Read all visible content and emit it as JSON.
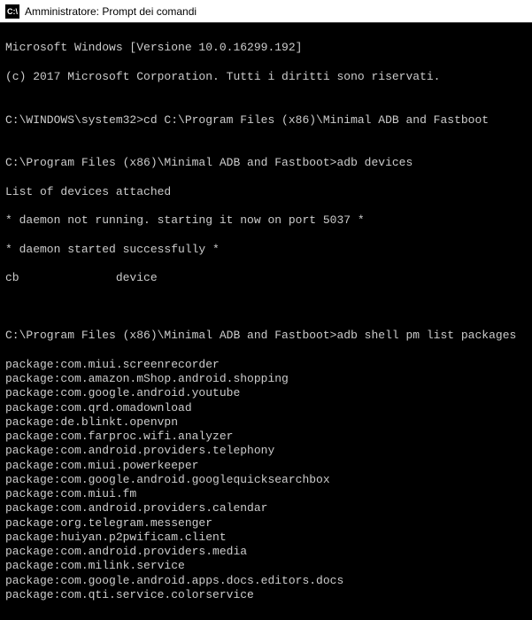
{
  "titlebar": {
    "icon_text": "C:\\",
    "title": "Amministratore: Prompt dei comandi"
  },
  "terminal": {
    "header1": "Microsoft Windows [Versione 10.0.16299.192]",
    "header2": "(c) 2017 Microsoft Corporation. Tutti i diritti sono riservati.",
    "blank": "",
    "prompt1": "C:\\WINDOWS\\system32>cd C:\\Program Files (x86)\\Minimal ADB and Fastboot",
    "prompt2": "C:\\Program Files (x86)\\Minimal ADB and Fastboot>adb devices",
    "dev_list_header": "List of devices attached",
    "daemon1": "* daemon not running. starting it now on port 5037 *",
    "daemon2": "* daemon started successfully *",
    "device_line": "cb              device",
    "prompt3": "C:\\Program Files (x86)\\Minimal ADB and Fastboot>adb shell pm list packages",
    "packages": [
      "package:com.miui.screenrecorder",
      "package:com.amazon.mShop.android.shopping",
      "package:com.google.android.youtube",
      "package:com.qrd.omadownload",
      "package:de.blinkt.openvpn",
      "package:com.farproc.wifi.analyzer",
      "package:com.android.providers.telephony",
      "package:com.miui.powerkeeper",
      "package:com.google.android.googlequicksearchbox",
      "package:com.miui.fm",
      "package:com.android.providers.calendar",
      "package:org.telegram.messenger",
      "package:huiyan.p2pwificam.client",
      "package:com.android.providers.media",
      "package:com.milink.service",
      "package:com.google.android.apps.docs.editors.docs",
      "package:com.qti.service.colorservice"
    ]
  }
}
